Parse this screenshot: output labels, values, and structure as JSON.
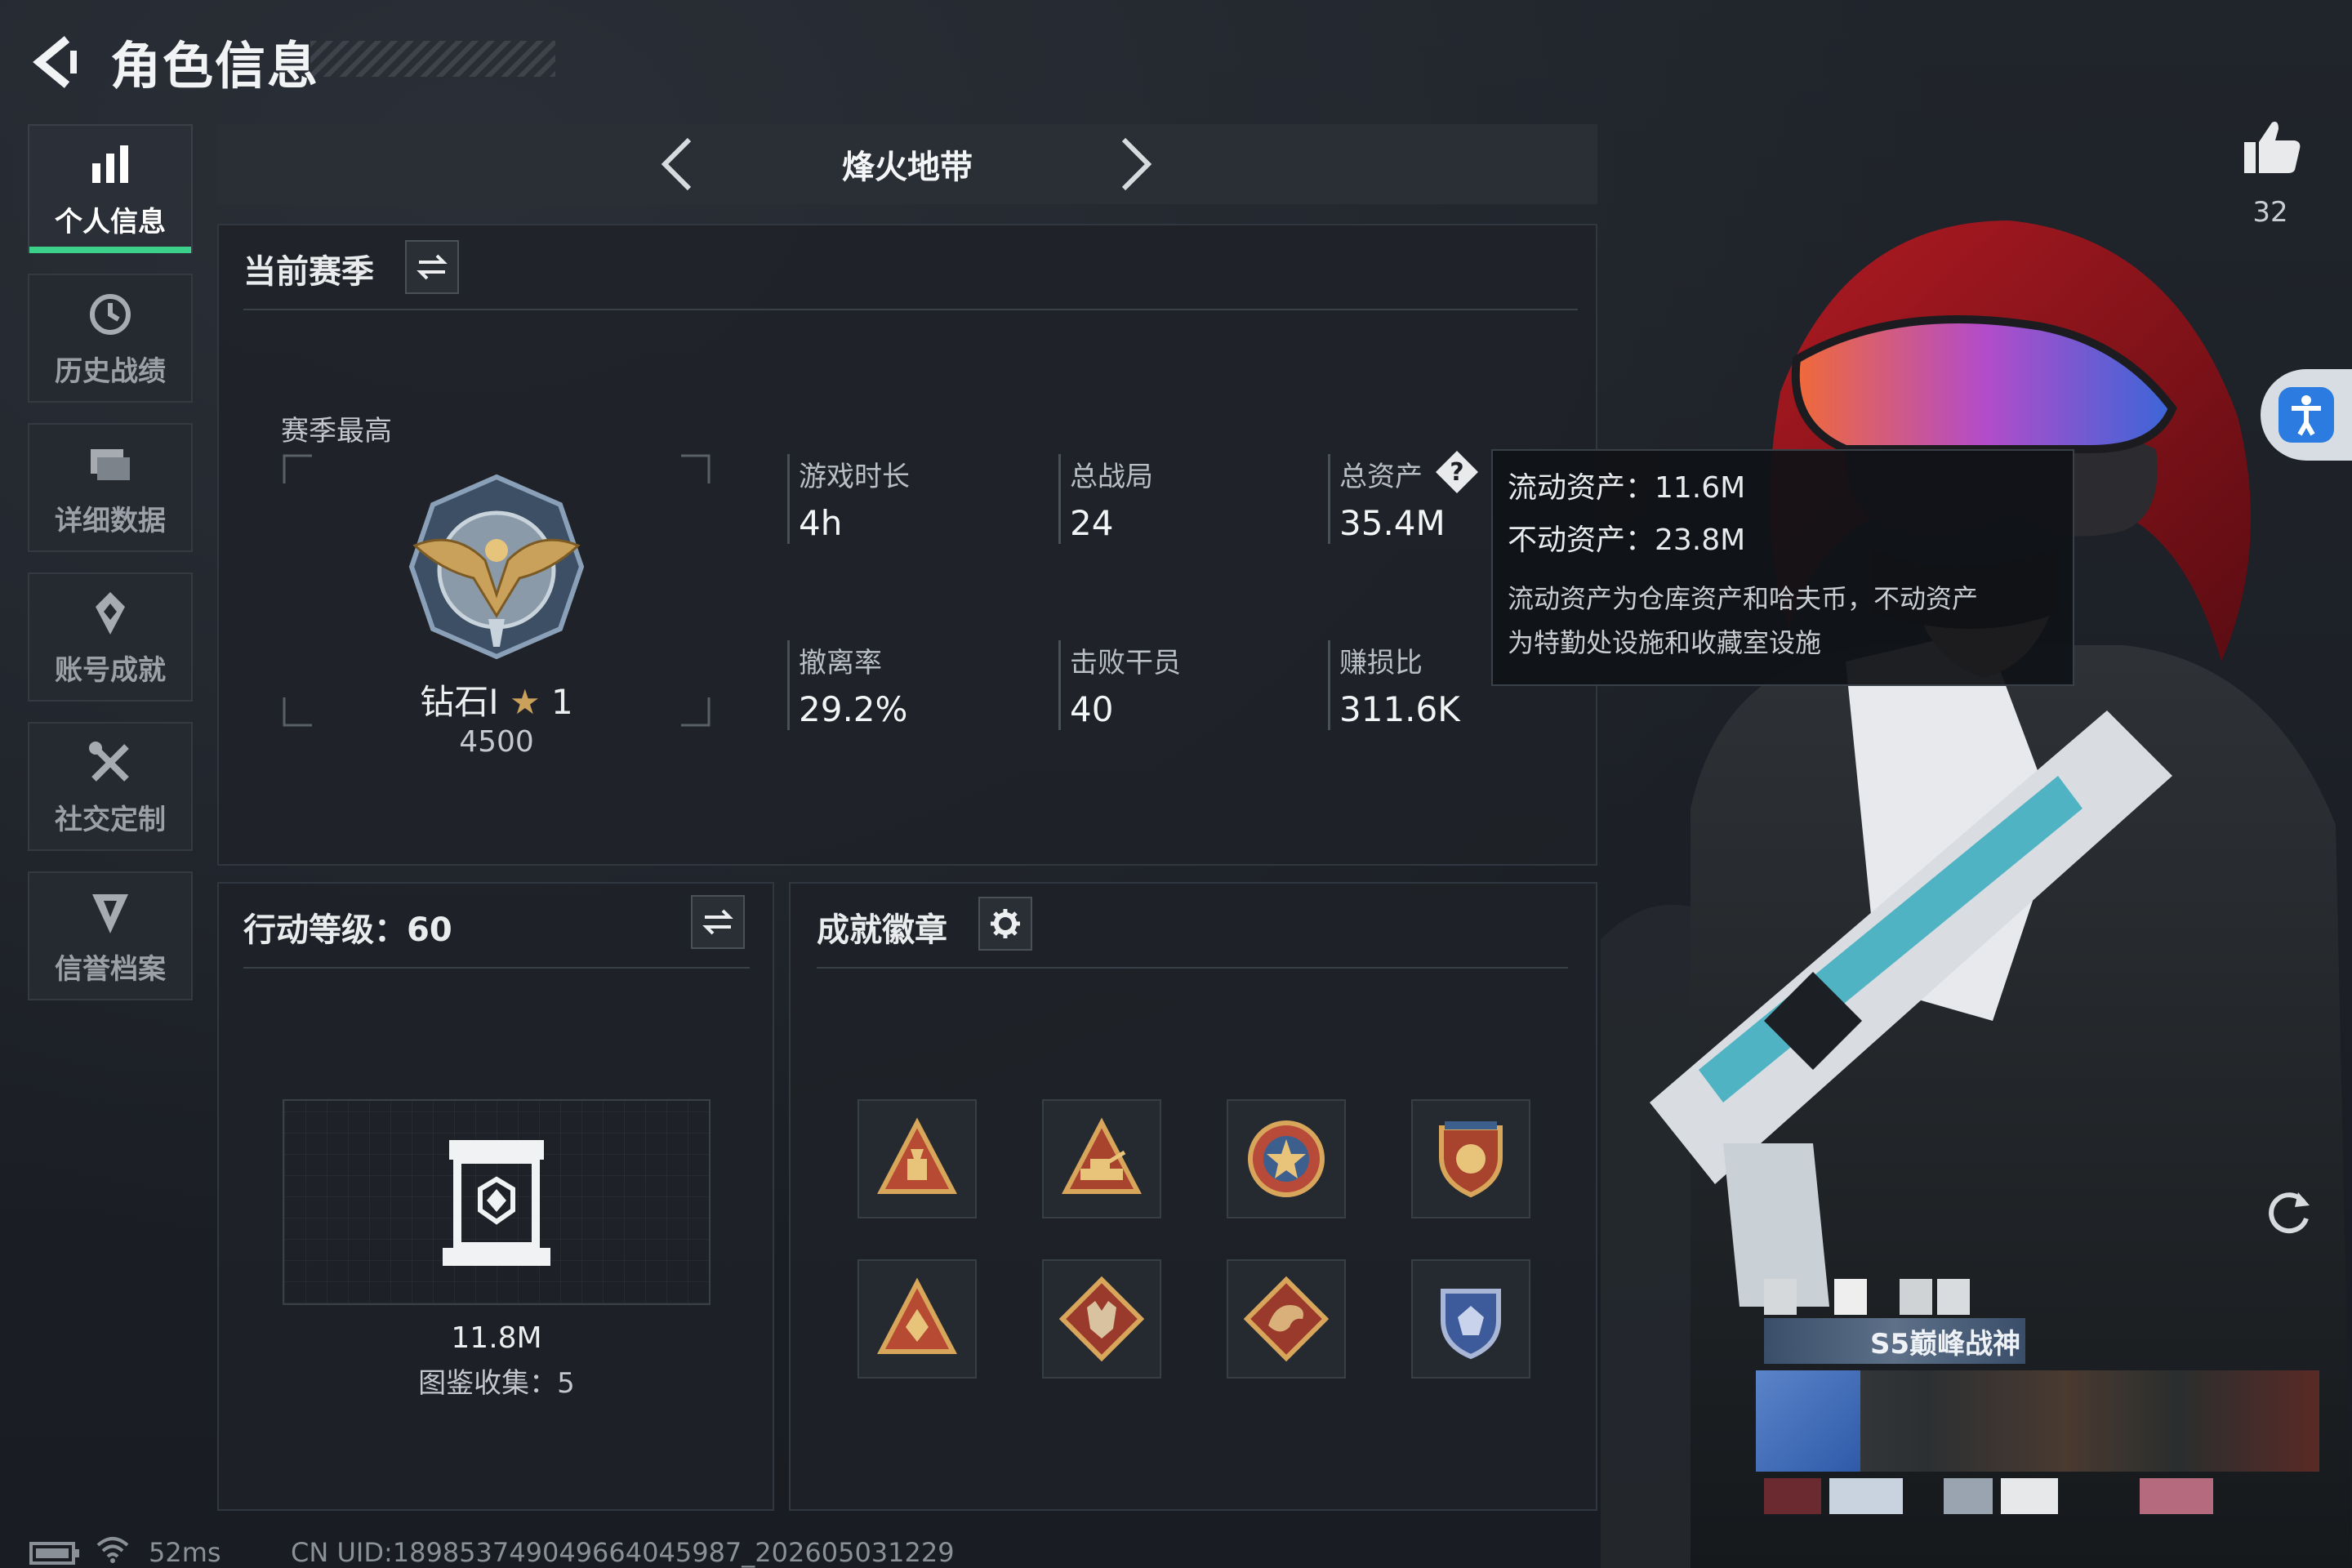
{
  "header": {
    "title": "角色信息"
  },
  "sidebar": {
    "items": [
      {
        "label": "个人信息",
        "icon": "bar-chart-icon",
        "active": true
      },
      {
        "label": "历史战绩",
        "icon": "history-icon"
      },
      {
        "label": "详细数据",
        "icon": "folder-icon"
      },
      {
        "label": "账号成就",
        "icon": "achievement-icon"
      },
      {
        "label": "社交定制",
        "icon": "tools-icon"
      },
      {
        "label": "信誉档案",
        "icon": "shield-icon"
      }
    ]
  },
  "mode": {
    "label": "烽火地带"
  },
  "season": {
    "title": "当前赛季",
    "best_label": "赛季最高",
    "rank": {
      "name": "钻石Ⅰ",
      "stars": "1",
      "score": "4500"
    },
    "stats": [
      {
        "label": "游戏时长",
        "value": "4h"
      },
      {
        "label": "总战局",
        "value": "24"
      },
      {
        "label": "总资产",
        "value": "35.4M"
      },
      {
        "label": "撤离率",
        "value": "29.2%"
      },
      {
        "label": "击败干员",
        "value": "40"
      },
      {
        "label": "赚损比",
        "value": "311.6K"
      }
    ]
  },
  "tooltip": {
    "liquid": "流动资产：11.6M",
    "fixed": "不动资产：23.8M",
    "note_line1": "流动资产为仓库资产和哈夫币，不动资产",
    "note_line2": "为特勤处设施和收藏室设施"
  },
  "action_level": {
    "title": "行动等级：60",
    "value": "11.8M",
    "collection": "图鉴收集：5"
  },
  "badges": {
    "title": "成就徽章",
    "items": [
      "triangle-badge-1",
      "triangle-badge-2",
      "star-badge",
      "shield-badge",
      "triangle-badge-3",
      "wolf-badge",
      "dragon-badge",
      "crest-badge"
    ]
  },
  "character": {
    "likes": "32",
    "title_badge": "S5巅峰战神"
  },
  "footer": {
    "ping": "52ms",
    "uid": "CN UID:18985374904966404598​7_202605031229"
  },
  "colors": {
    "accent_green": "#3bd18b",
    "panel_bg": "#1e2228",
    "text": "#e6e8ea"
  }
}
